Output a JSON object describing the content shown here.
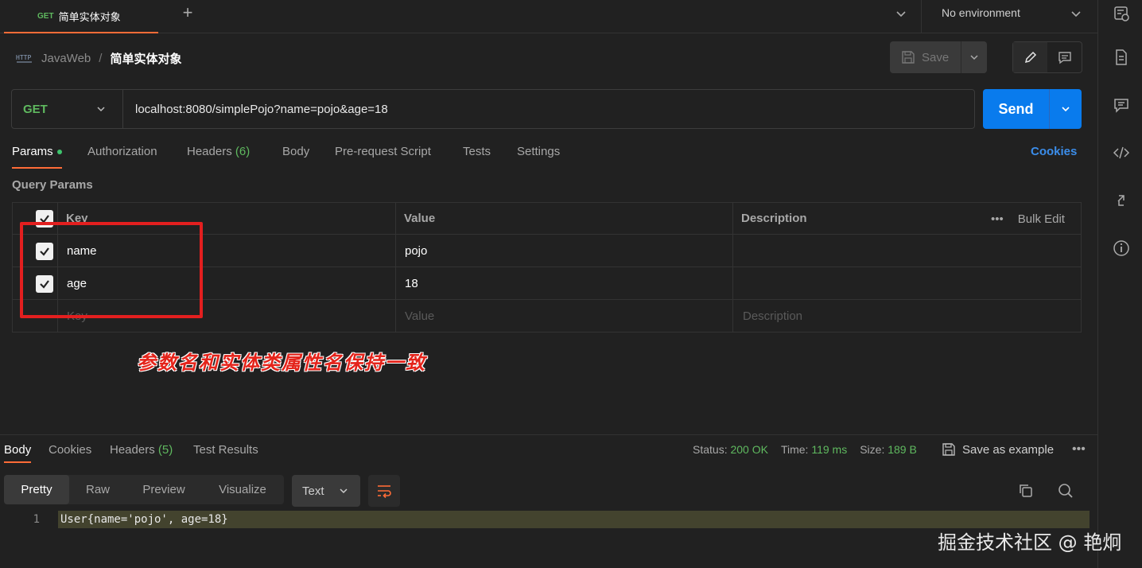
{
  "tabbar": {
    "active_tab": {
      "method": "GET",
      "title": "简单实体对象"
    },
    "environment": "No environment"
  },
  "breadcrumb": {
    "collection": "JavaWeb",
    "separator": "/",
    "request": "简单实体对象"
  },
  "toolbar": {
    "save_label": "Save"
  },
  "request": {
    "method": "GET",
    "url": "localhost:8080/simplePojo?name=pojo&age=18",
    "send_label": "Send"
  },
  "request_tabs": [
    {
      "label": "Params"
    },
    {
      "label": "Authorization"
    },
    {
      "label": "Headers",
      "count": "(6)"
    },
    {
      "label": "Body"
    },
    {
      "label": "Pre-request Script"
    },
    {
      "label": "Tests"
    },
    {
      "label": "Settings"
    }
  ],
  "cookies_label": "Cookies",
  "query_params": {
    "title": "Query Params",
    "headers": {
      "key": "Key",
      "value": "Value",
      "description": "Description",
      "bulk_edit": "Bulk Edit"
    },
    "rows": [
      {
        "key": "name",
        "value": "pojo",
        "checked": true
      },
      {
        "key": "age",
        "value": "18",
        "checked": true
      }
    ],
    "placeholders": {
      "key": "Key",
      "value": "Value",
      "description": "Description"
    }
  },
  "annotation": "参数名和实体类属性名保持一致",
  "annotation_color": "#e4231a",
  "response": {
    "tabs": [
      {
        "label": "Body"
      },
      {
        "label": "Cookies"
      },
      {
        "label": "Headers",
        "count": "(5)"
      },
      {
        "label": "Test Results"
      }
    ],
    "status_label": "Status:",
    "status_value": "200 OK",
    "time_label": "Time:",
    "time_value": "119 ms",
    "size_label": "Size:",
    "size_value": "189 B",
    "save_example": "Save as example",
    "formats": [
      "Pretty",
      "Raw",
      "Preview",
      "Visualize"
    ],
    "language": "Text",
    "line_number": "1",
    "body": "User{name='pojo', age=18}"
  },
  "watermark": "掘金技术社区 @ 艳炯",
  "colors": {
    "accent": "#ff6c37",
    "send": "#097bed",
    "get": "#5fb95f",
    "link": "#3b8dea"
  }
}
